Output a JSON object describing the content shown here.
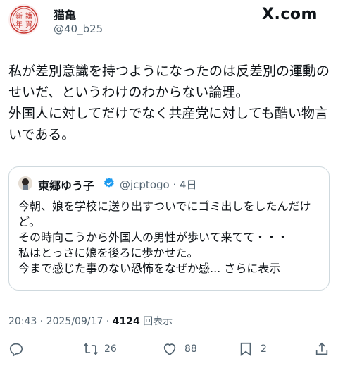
{
  "author": {
    "name": "猫亀",
    "handle": "@40_b25",
    "avatar_stamp": "新年護賀"
  },
  "brand": "X.com",
  "post": {
    "text": "私が差別意識を持つようになったのは反差別の運動のせいだ、というわけのわからない論理。\n外国人に対してだけでなく共産党に対しても酷い物言いである。"
  },
  "quote": {
    "name": "東郷ゆう子",
    "handle_time": "@jcptogo · 4日",
    "text": "今朝、娘を学校に送り出すついでにゴミ出しをしたんだけど。\nその時向こうから外国人の男性が歩いて来てて・・・\n私はとっさに娘を後ろに歩かせた。\n今まで感じた事のない恐怖をなぜか感... さらに表示"
  },
  "meta": {
    "datetime": "20:43 · 2025/09/17 · ",
    "views": "4124",
    "views_label": " 回表示"
  },
  "actions": {
    "reposts": "26",
    "likes": "88",
    "bookmarks": "2"
  },
  "colors": {
    "text": "#0f1419",
    "secondary": "#536471",
    "border": "#cfd9de",
    "verified": "#1d9bf0",
    "stamp": "#c8352f"
  }
}
